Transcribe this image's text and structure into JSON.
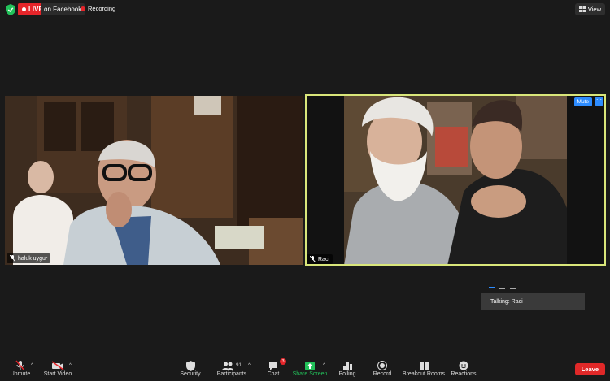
{
  "topbar": {
    "live_badge": "LIVE",
    "live_target": "on Facebook",
    "recording": "Recording",
    "view_label": "View"
  },
  "tiles": {
    "left_name": "haluk uygur",
    "right_name": "Raci",
    "mute_label": "Mute",
    "more_label": "⋯"
  },
  "talking": {
    "label": "Talking: Raci"
  },
  "toolbar": {
    "unmute": "Unmute",
    "start_video": "Start Video",
    "security": "Security",
    "participants": "Participants",
    "participants_count": "91",
    "chat": "Chat",
    "chat_badge": "3",
    "share_screen": "Share Screen",
    "polling": "Polling",
    "record": "Record",
    "breakout_rooms": "Breakout Rooms",
    "reactions": "Reactions",
    "leave": "Leave"
  },
  "colors": {
    "live_red": "#e5252a",
    "active_speaker_border": "#d9e67a",
    "accent_blue": "#2d8cff",
    "share_green": "#22c25a",
    "leave_red": "#e02828"
  }
}
